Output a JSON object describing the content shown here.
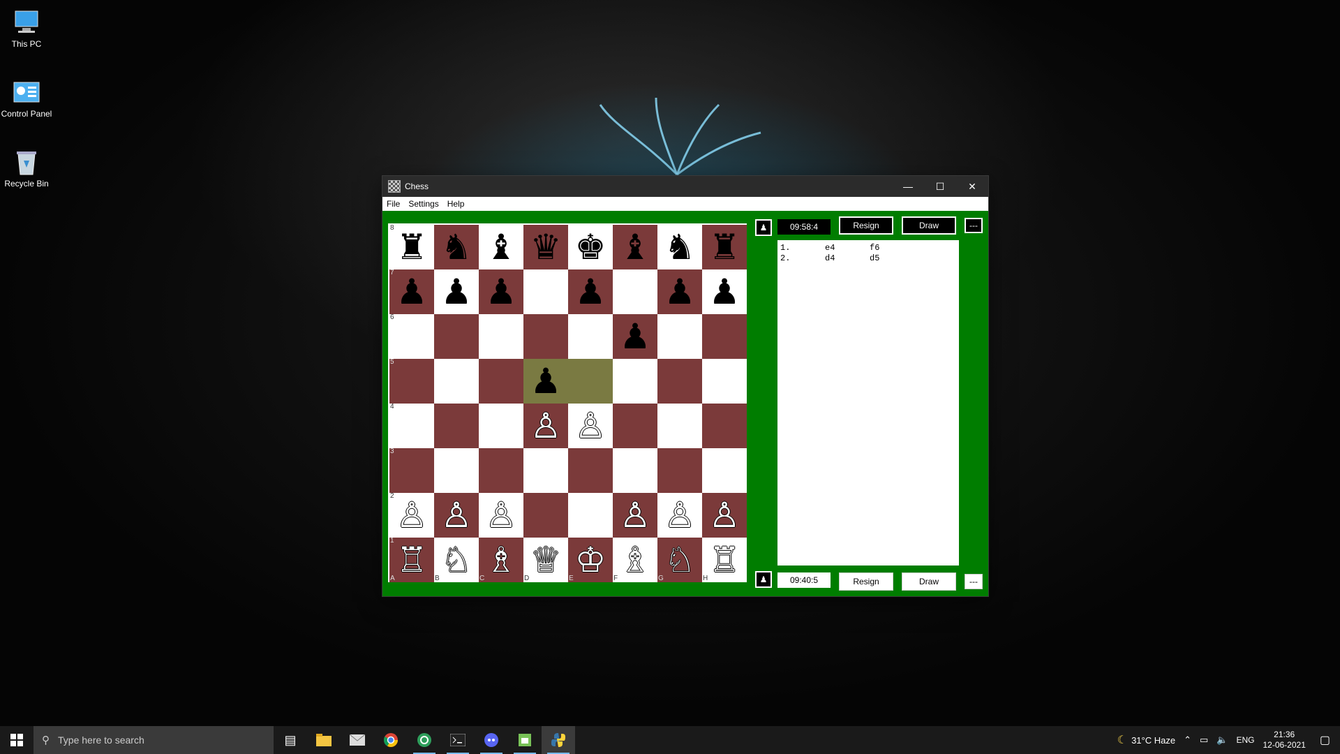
{
  "desktop": {
    "icons": [
      {
        "label": "This PC"
      },
      {
        "label": "Control Panel"
      },
      {
        "label": "Recycle Bin"
      }
    ]
  },
  "window": {
    "title": "Chess",
    "controls": {
      "minimize": "—",
      "maximize": "☐",
      "close": "✕"
    },
    "menu": [
      "File",
      "Settings",
      "Help"
    ]
  },
  "board": {
    "colors": {
      "light": "#ffffff",
      "dark": "#7b3a3a",
      "highlight": "#7a7a42"
    },
    "ranks": [
      "8",
      "7",
      "6",
      "5",
      "4",
      "3",
      "2",
      "1"
    ],
    "files": [
      "A",
      "B",
      "C",
      "D",
      "E",
      "F",
      "G",
      "H"
    ],
    "rows": [
      [
        "♜",
        "♞",
        "♝",
        "♛",
        "♚",
        "♝",
        "♞",
        "♜"
      ],
      [
        "♟",
        "♟",
        "♟",
        "",
        "♟",
        "",
        "♟",
        "♟"
      ],
      [
        "",
        "",
        "",
        "",
        "",
        "♟",
        "",
        ""
      ],
      [
        "",
        "",
        "",
        "♟",
        "",
        "",
        "",
        ""
      ],
      [
        "",
        "",
        "",
        "♙",
        "♙",
        "",
        "",
        ""
      ],
      [
        "",
        "",
        "",
        "",
        "",
        "",
        "",
        ""
      ],
      [
        "♙",
        "♙",
        "♙",
        "",
        "",
        "♙",
        "♙",
        "♙"
      ],
      [
        "♖",
        "♘",
        "♗",
        "♕",
        "♔",
        "♗",
        "♘",
        "♖"
      ]
    ],
    "highlighted": [
      "d5",
      "e5"
    ]
  },
  "black_panel": {
    "clock": "09:58:4",
    "resign": "Resign",
    "draw": "Draw",
    "more": "---"
  },
  "white_panel": {
    "clock": "09:40:5",
    "resign": "Resign",
    "draw": "Draw",
    "more": "---"
  },
  "moves": [
    {
      "num": "1.",
      "white": "e4",
      "black": "f6"
    },
    {
      "num": "2.",
      "white": "d4",
      "black": "d5"
    }
  ],
  "taskbar": {
    "search_placeholder": "Type here to search",
    "apps": [
      "task-view",
      "file-explorer",
      "mail",
      "chrome",
      "app-green",
      "terminal",
      "discord",
      "android",
      "python"
    ],
    "weather": "31°C  Haze",
    "language": "ENG",
    "time": "21:36",
    "date": "12-06-2021"
  }
}
